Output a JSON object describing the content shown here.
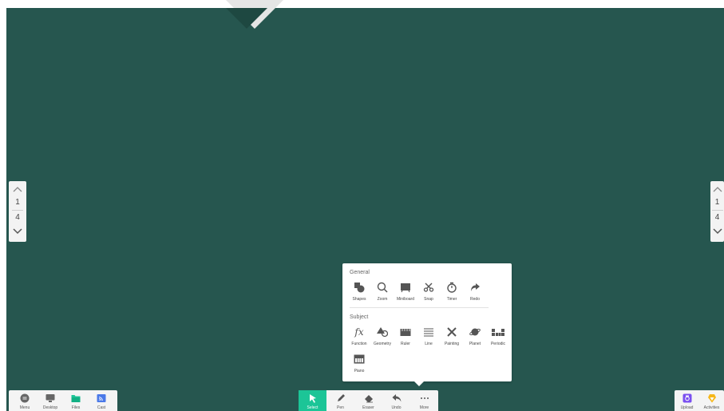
{
  "colors": {
    "board": "#26564f",
    "accent": "#1cc597",
    "panel": "#ffffff",
    "dock": "#f4f4f4"
  },
  "pager": {
    "current": "1",
    "total": "4"
  },
  "more_panel": {
    "general_title": "General",
    "general_tools": [
      {
        "label": "Shapes",
        "icon": "shapes-icon"
      },
      {
        "label": "Zoom",
        "icon": "zoom-icon"
      },
      {
        "label": "Miniboard",
        "icon": "miniboard-icon"
      },
      {
        "label": "Snap",
        "icon": "scissors-icon"
      },
      {
        "label": "Timer",
        "icon": "timer-icon"
      },
      {
        "label": "Redo",
        "icon": "redo-icon"
      }
    ],
    "subject_title": "Subject",
    "subject_tools": [
      {
        "label": "Function",
        "icon": "function-icon"
      },
      {
        "label": "Geometry",
        "icon": "geometry-icon"
      },
      {
        "label": "Ruler",
        "icon": "ruler-icon"
      },
      {
        "label": "Line",
        "icon": "line-icon"
      },
      {
        "label": "Painting",
        "icon": "painting-icon"
      },
      {
        "label": "Planet",
        "icon": "planet-icon"
      },
      {
        "label": "Periodic",
        "icon": "periodic-icon"
      },
      {
        "label": "Piano",
        "icon": "piano-icon"
      }
    ]
  },
  "dock_left": [
    {
      "label": "Menu",
      "icon": "menu-icon"
    },
    {
      "label": "Desktop",
      "icon": "desktop-icon"
    },
    {
      "label": "Files",
      "icon": "folder-icon"
    },
    {
      "label": "Cast",
      "icon": "cast-icon"
    }
  ],
  "dock_center": [
    {
      "label": "Select",
      "icon": "cursor-icon"
    },
    {
      "label": "Pen",
      "icon": "pen-icon"
    },
    {
      "label": "Eraser",
      "icon": "eraser-icon"
    },
    {
      "label": "Undo",
      "icon": "undo-icon"
    },
    {
      "label": "More",
      "icon": "more-icon"
    }
  ],
  "dock_right": [
    {
      "label": "Upload",
      "icon": "upload-icon"
    },
    {
      "label": "Activities",
      "icon": "activities-icon"
    }
  ]
}
